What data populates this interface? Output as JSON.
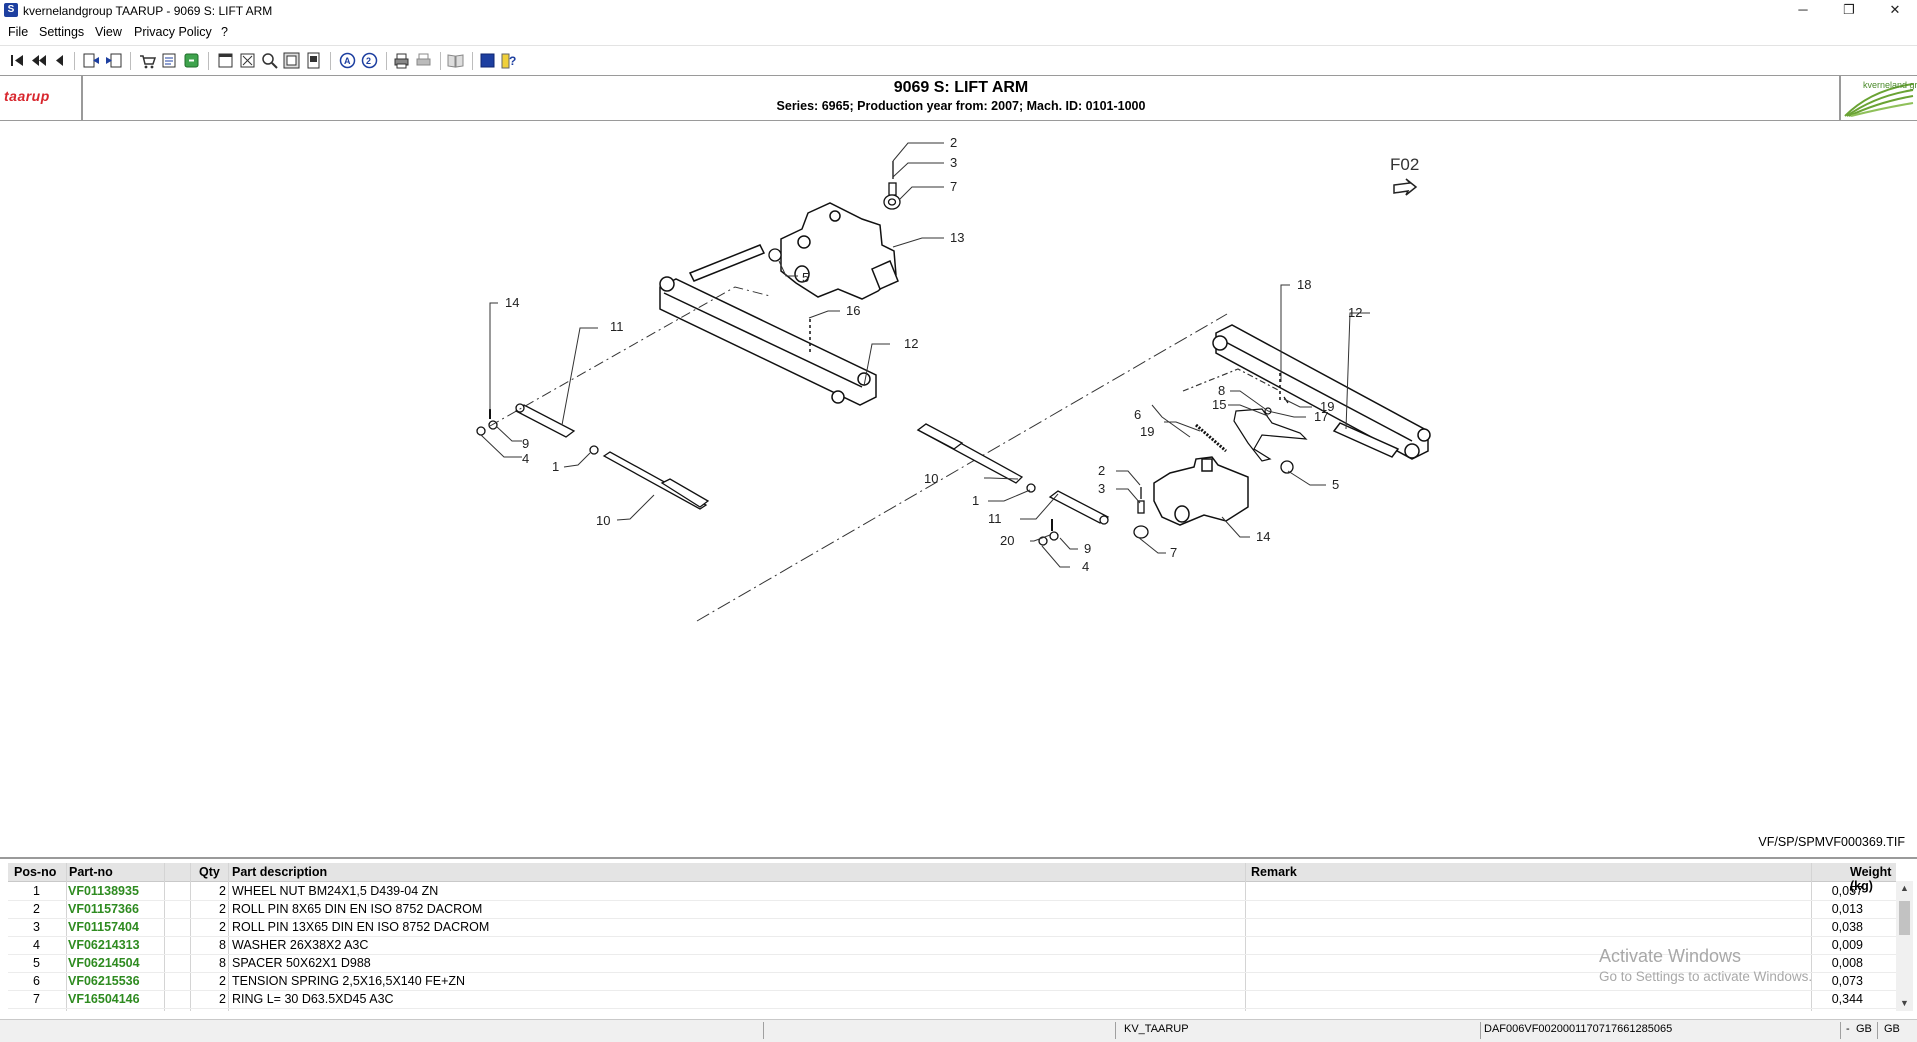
{
  "window": {
    "title": "kvernelandgroup TAARUP - 9069 S: LIFT ARM",
    "minimize": "─",
    "restore": "❐",
    "close": "✕"
  },
  "menu": [
    "File",
    "Settings",
    "View",
    "Privacy Policy",
    "?"
  ],
  "toolbar": {
    "buttons": [
      "first-page-icon",
      "previous-chapter-icon",
      "previous-page-icon",
      "back-icon",
      "forward-icon",
      "cart-icon",
      "order-list-icon",
      "export-icon",
      "index-icon",
      "zoom-fit-icon",
      "zoom-icon",
      "page-view-icon",
      "page-icon",
      "search-a-icon",
      "search-2-icon",
      "print-icon",
      "print-preview-icon",
      "book-icon",
      "stop-icon",
      "help-icon"
    ]
  },
  "header": {
    "brand_left": "taarup",
    "brand_right": "kverneland group",
    "title": "9069 S: LIFT ARM",
    "subtitle": "Series: 6965; Production year from: 2007; Mach. ID: 0101-1000"
  },
  "drawing": {
    "sheet_label": "F02",
    "file_name": "VF/SP/SPMVF000369.TIF",
    "callouts": [
      "2",
      "3",
      "7",
      "13",
      "5",
      "14",
      "11",
      "16",
      "12",
      "9",
      "4",
      "1",
      "10",
      "18",
      "12",
      "8",
      "15",
      "19",
      "6",
      "19",
      "17",
      "5",
      "2",
      "3",
      "10",
      "1",
      "11",
      "20",
      "9",
      "4",
      "7",
      "14"
    ]
  },
  "table": {
    "headers": {
      "pos": "Pos-no",
      "part": "Part-no",
      "qty": "Qty",
      "desc": "Part description",
      "remark": "Remark",
      "weight": "Weight (kg)"
    },
    "rows": [
      {
        "pos": "1",
        "part": "VF01138935",
        "qty": "2",
        "desc": "WHEEL NUT BM24X1,5  D439-04 ZN",
        "remark": "",
        "weight": "0,057"
      },
      {
        "pos": "2",
        "part": "VF01157366",
        "qty": "2",
        "desc": "ROLL PIN 8X65 DIN EN ISO 8752 DACROM",
        "remark": "",
        "weight": "0,013"
      },
      {
        "pos": "3",
        "part": "VF01157404",
        "qty": "2",
        "desc": "ROLL PIN 13X65 DIN EN ISO 8752 DACROM",
        "remark": "",
        "weight": "0,038"
      },
      {
        "pos": "4",
        "part": "VF06214313",
        "qty": "8",
        "desc": "WASHER 26X38X2 A3C",
        "remark": "",
        "weight": "0,009"
      },
      {
        "pos": "5",
        "part": "VF06214504",
        "qty": "8",
        "desc": "SPACER 50X62X1 D988",
        "remark": "",
        "weight": "0,008"
      },
      {
        "pos": "6",
        "part": "VF06215536",
        "qty": "2",
        "desc": "TENSION SPRING 2,5X16,5X140 FE+ZN",
        "remark": "",
        "weight": "0,073"
      },
      {
        "pos": "7",
        "part": "VF16504146",
        "qty": "2",
        "desc": "RING  L=  30 D63.5XD45  A3C",
        "remark": "",
        "weight": "0,344"
      }
    ]
  },
  "watermark": {
    "line1": "Activate Windows",
    "line2": "Go to Settings to activate Windows."
  },
  "status": {
    "catalog": "KV_TAARUP",
    "document_id": "DAF006VF0020001170717661285065",
    "lang1": "GB",
    "lang2": "GB",
    "marker": "-"
  },
  "colors": {
    "part_link": "#2e8b20",
    "brand_red": "#d8262d",
    "brand_green": "#6aa334"
  }
}
